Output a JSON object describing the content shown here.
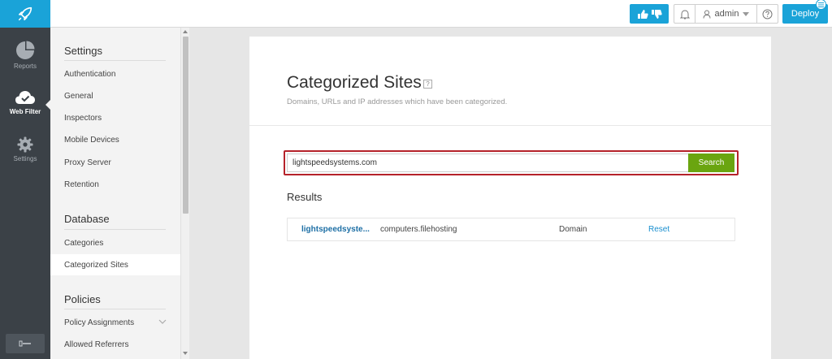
{
  "topbar": {
    "user": "admin",
    "deploy_label": "Deploy"
  },
  "rail": {
    "items": [
      {
        "label": "Reports",
        "icon": "pie-chart-icon"
      },
      {
        "label": "Web Filter",
        "icon": "cloud-check-icon"
      },
      {
        "label": "Settings",
        "icon": "gear-icon"
      }
    ]
  },
  "nav": {
    "settings_heading": "Settings",
    "settings_items": [
      "Authentication",
      "General",
      "Inspectors",
      "Mobile Devices",
      "Proxy Server",
      "Retention"
    ],
    "database_heading": "Database",
    "database_items": [
      "Categories",
      "Categorized Sites"
    ],
    "policies_heading": "Policies",
    "policies_items": [
      "Policy Assignments",
      "Allowed Referrers"
    ]
  },
  "main": {
    "title": "Categorized Sites",
    "help_glyph": "?",
    "subtitle": "Domains, URLs and IP addresses which have been categorized.",
    "search_value": "lightspeedsystems.com",
    "search_button": "Search",
    "results_heading": "Results",
    "results": [
      {
        "domain": "lightspeedsyste...",
        "category": "computers.filehosting",
        "type": "Domain",
        "action": "Reset"
      }
    ]
  },
  "colors": {
    "brand_blue": "#1aa3d8",
    "search_green": "#6aa510",
    "highlight_red": "#b5222a",
    "rail_dark": "#3b4147"
  }
}
